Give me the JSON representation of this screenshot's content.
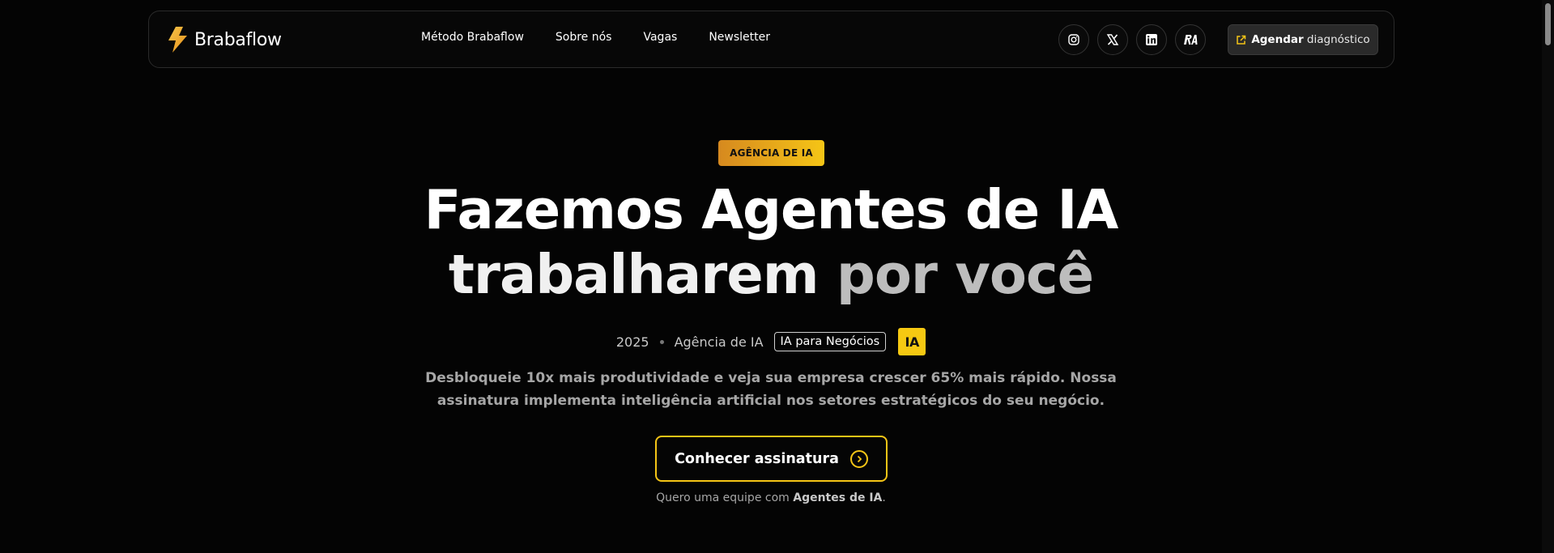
{
  "brand": {
    "name": "Brabaflow"
  },
  "nav": {
    "links": [
      "Método Brabaflow",
      "Sobre nós",
      "Vagas",
      "Newsletter"
    ],
    "socials": [
      {
        "name": "instagram-icon"
      },
      {
        "name": "x-twitter-icon"
      },
      {
        "name": "linkedin-icon"
      },
      {
        "name": "ra-logo-icon"
      }
    ],
    "cta_bold": "Agendar",
    "cta_light": "diagnóstico"
  },
  "hero": {
    "badge": "AGÊNCIA DE IA",
    "title_line1": "Fazemos Agentes de IA",
    "title_line2_main": "trabalharem ",
    "title_line2_highlight": "por você",
    "meta_year": "2025",
    "meta_agency": "Agência de IA",
    "meta_pill": "IA para Negócios",
    "meta_ia_badge": "IA",
    "desc_line1": "Desbloqueie 10x mais produtividade e veja sua empresa crescer 65% mais rápido. Nossa",
    "desc_line2": "assinatura implementa inteligência artificial nos setores estratégicos do seu negócio.",
    "cta_label": "Conhecer assinatura",
    "subnote_prefix": "Quero uma equipe com ",
    "subnote_bold": "Agentes de IA",
    "subnote_suffix": "."
  },
  "colors": {
    "background": "#040404",
    "accent_yellow": "#f5c516",
    "accent_orange": "#d6891f"
  }
}
